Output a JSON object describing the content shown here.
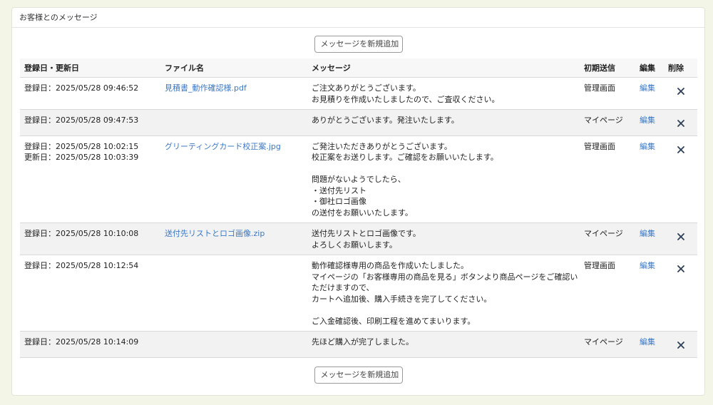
{
  "panel": {
    "title": "お客様とのメッセージ"
  },
  "add_button_label": "メッセージを新規追加",
  "table": {
    "headers": {
      "date": "登録日・更新日",
      "file": "ファイル名",
      "message": "メッセージ",
      "initial_sender": "初期送信",
      "edit": "編集",
      "delete": "削除"
    },
    "rows": [
      {
        "dates": [
          "登録日：2025/05/28 09:46:52"
        ],
        "file": "見積書_動作確認様.pdf",
        "message_lines": [
          "ご注文ありがとうございます。",
          "お見積りを作成いたしましたので、ご査収ください。"
        ],
        "sender": "管理画面",
        "edit": "編集"
      },
      {
        "dates": [
          "登録日：2025/05/28 09:47:53"
        ],
        "file": "",
        "message_lines": [
          "ありがとうございます。発注いたします。"
        ],
        "sender": "マイページ",
        "edit": "編集"
      },
      {
        "dates": [
          "登録日：2025/05/28 10:02:15",
          "更新日：2025/05/28 10:03:39"
        ],
        "file": "グリーティングカード校正案.jpg",
        "message_lines": [
          "ご発注いただきありがとうございます。",
          "校正案をお送りします。ご確認をお願いいたします。",
          "",
          "問題がないようでしたら、",
          "・送付先リスト",
          "・御社ロゴ画像",
          "の送付をお願いいたします。"
        ],
        "sender": "管理画面",
        "edit": "編集"
      },
      {
        "dates": [
          "登録日：2025/05/28 10:10:08"
        ],
        "file": "送付先リストとロゴ画像.zip",
        "message_lines": [
          "送付先リストとロゴ画像です。",
          "よろしくお願いします。"
        ],
        "sender": "マイページ",
        "edit": "編集"
      },
      {
        "dates": [
          "登録日：2025/05/28 10:12:54"
        ],
        "file": "",
        "message_lines": [
          "動作確認様専用の商品を作成いたしました。",
          "マイページの「お客様専用の商品を見る」ボタンより商品ページをご確認い",
          "ただけますので、",
          "カートへ追加後、購入手続きを完了してください。",
          "",
          "ご入金確認後、印刷工程を進めてまいります。"
        ],
        "sender": "管理画面",
        "edit": "編集"
      },
      {
        "dates": [
          "登録日：2025/05/28 10:14:09"
        ],
        "file": "",
        "message_lines": [
          "先ほど購入が完了しました。"
        ],
        "sender": "マイページ",
        "edit": "編集"
      }
    ]
  },
  "colors": {
    "page_background": "#f3f5e6",
    "link": "#3b78c4",
    "row_alt": "#f2f2f2",
    "delete_icon": "#2e3f55"
  },
  "icons": {
    "delete": "close-icon"
  }
}
